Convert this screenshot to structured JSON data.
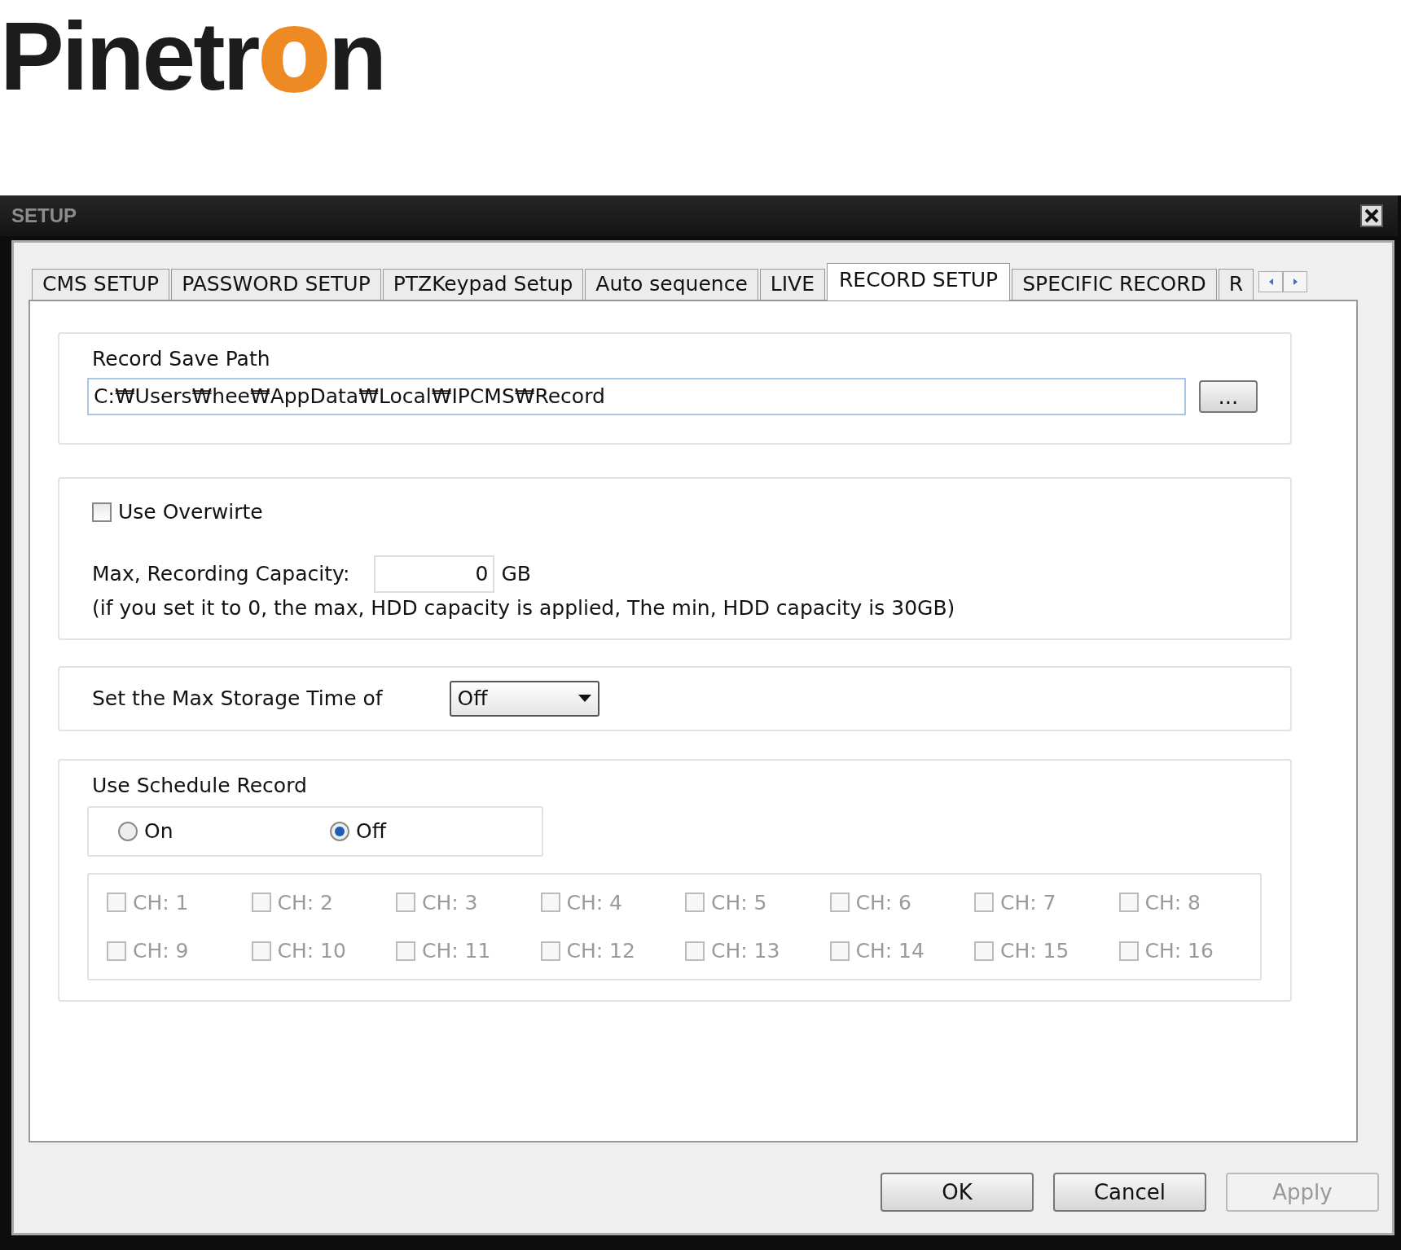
{
  "logo": "Pinetr**o**n",
  "window": {
    "title": "SETUP"
  },
  "tabs": [
    {
      "label": "CMS SETUP",
      "selected": false
    },
    {
      "label": "PASSWORD SETUP",
      "selected": false
    },
    {
      "label": "PTZKeypad Setup",
      "selected": false
    },
    {
      "label": "Auto sequence",
      "selected": false
    },
    {
      "label": "LIVE",
      "selected": false
    },
    {
      "label": "RECORD SETUP",
      "selected": true
    },
    {
      "label": "SPECIFIC RECORD",
      "selected": false
    },
    {
      "label": "R",
      "selected": false
    }
  ],
  "record_save_path": {
    "label": "Record Save Path",
    "value": "C:₩Users₩hee₩AppData₩Local₩IPCMS₩Record",
    "browse_button": "..."
  },
  "overwrite": {
    "label": "Use Overwirte",
    "checked": false
  },
  "capacity": {
    "label": "Max, Recording Capacity:",
    "value": "0",
    "unit": "GB",
    "note": "(if you set it to 0, the max, HDD capacity is applied, The min, HDD capacity is 30GB)"
  },
  "storage_time": {
    "label": "Set the Max Storage Time of",
    "value": "Off"
  },
  "schedule": {
    "label": "Use Schedule Record",
    "options": [
      {
        "label": "On",
        "selected": false
      },
      {
        "label": "Off",
        "selected": true
      }
    ],
    "channels": [
      {
        "label": "CH: 1",
        "checked": false,
        "disabled": true
      },
      {
        "label": "CH: 2",
        "checked": false,
        "disabled": true
      },
      {
        "label": "CH: 3",
        "checked": false,
        "disabled": true
      },
      {
        "label": "CH: 4",
        "checked": false,
        "disabled": true
      },
      {
        "label": "CH: 5",
        "checked": false,
        "disabled": true
      },
      {
        "label": "CH: 6",
        "checked": false,
        "disabled": true
      },
      {
        "label": "CH: 7",
        "checked": false,
        "disabled": true
      },
      {
        "label": "CH: 8",
        "checked": false,
        "disabled": true
      },
      {
        "label": "CH: 9",
        "checked": false,
        "disabled": true
      },
      {
        "label": "CH: 10",
        "checked": false,
        "disabled": true
      },
      {
        "label": "CH: 11",
        "checked": false,
        "disabled": true
      },
      {
        "label": "CH: 12",
        "checked": false,
        "disabled": true
      },
      {
        "label": "CH: 13",
        "checked": false,
        "disabled": true
      },
      {
        "label": "CH: 14",
        "checked": false,
        "disabled": true
      },
      {
        "label": "CH: 15",
        "checked": false,
        "disabled": true
      },
      {
        "label": "CH: 16",
        "checked": false,
        "disabled": true
      }
    ]
  },
  "buttons": [
    {
      "label": "OK",
      "disabled": false
    },
    {
      "label": "Cancel",
      "disabled": false
    },
    {
      "label": "Apply",
      "disabled": true
    }
  ]
}
